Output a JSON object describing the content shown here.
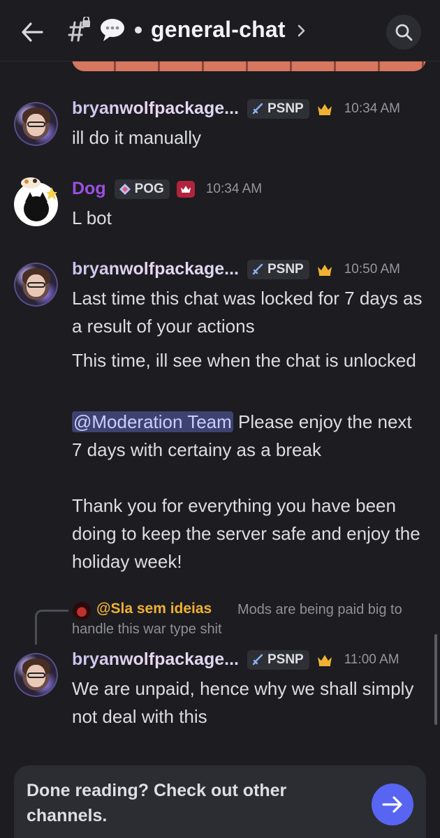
{
  "header": {
    "channel_name": "general-chat"
  },
  "messages": [
    {
      "username": "bryanwolfpackage...",
      "tag": "PSNP",
      "time": "10:34 AM",
      "lines": [
        "ill do it manually"
      ]
    },
    {
      "username": "Dog",
      "tag": "POG",
      "time": "10:34 AM",
      "lines": [
        "L bot"
      ]
    },
    {
      "username": "bryanwolfpackage...",
      "tag": "PSNP",
      "time": "10:50 AM",
      "paragraphs": [
        "Last time this chat was locked for 7 days as a result of your actions",
        "This time, ill see when the chat is unlocked"
      ],
      "mention": "@Moderation Team",
      "mention_text": " Please enjoy the next 7 days with certainy as a break",
      "closing": "Thank you for everything you have been doing to keep the server safe and enjoy the holiday week!"
    },
    {
      "reply": {
        "username": "@Sla sem ideias",
        "text_line1": "Mods are being paid big to",
        "text_line2": "handle this war type shit"
      },
      "username": "bryanwolfpackage...",
      "tag": "PSNP",
      "time": "11:00 AM",
      "paragraphs": [
        "We are unpaid, hence why we shall simply not deal with this"
      ]
    }
  ],
  "footer": {
    "prompt": "Done reading? Check out other channels."
  },
  "colors": {
    "background": "#1c1c21",
    "dog_name": "#9b51e0",
    "reply_name": "#f0b132",
    "mention_bg": "#3d4270",
    "send_button": "#5865f2"
  },
  "icons": [
    "back-arrow-icon",
    "hash-lock-icon",
    "speech-bubble-icon",
    "chevron-right-icon",
    "search-icon",
    "sword-icon",
    "crown-icon",
    "arrow-right-icon"
  ]
}
